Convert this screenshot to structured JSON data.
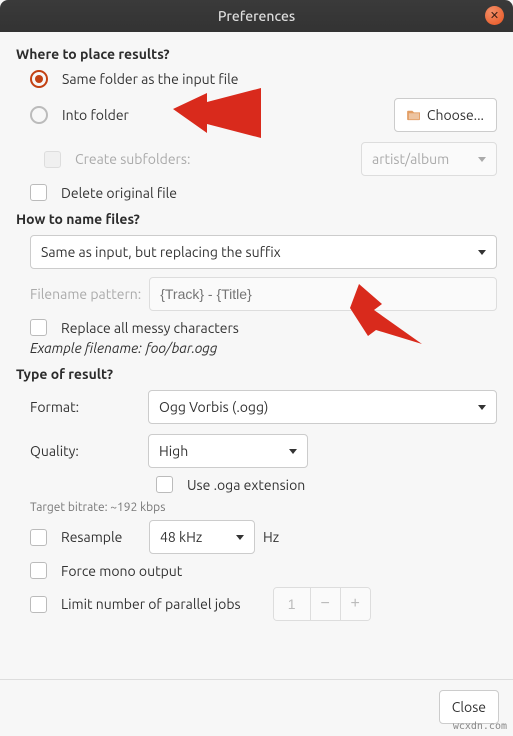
{
  "title": "Preferences",
  "sections": {
    "place": {
      "heading": "Where to place results?",
      "radio_same": "Same folder as the input file",
      "radio_into": "Into folder",
      "choose_btn": "Choose...",
      "create_subfolders": "Create subfolders:",
      "subfolder_template": "artist/album",
      "delete_original": "Delete original file"
    },
    "name": {
      "heading": "How to name files?",
      "mode": "Same as input, but replacing the suffix",
      "pattern_label": "Filename pattern:",
      "pattern_placeholder": "{Track} - {Title}",
      "replace_messy": "Replace all messy characters",
      "example_prefix": "Example filename: ",
      "example_value": "foo/bar.ogg"
    },
    "type": {
      "heading": "Type of result?",
      "format_label": "Format:",
      "format_value": "Ogg Vorbis (.ogg)",
      "quality_label": "Quality:",
      "quality_value": "High",
      "use_oga": "Use .oga extension",
      "target_bitrate": "Target bitrate: ~192 kbps",
      "resample_label": "Resample",
      "resample_value": "48 kHz",
      "resample_unit": "Hz",
      "force_mono": "Force mono output",
      "limit_jobs": "Limit number of parallel jobs",
      "jobs_value": "1"
    }
  },
  "footer": {
    "close": "Close"
  },
  "watermark": "wcxdn.com"
}
